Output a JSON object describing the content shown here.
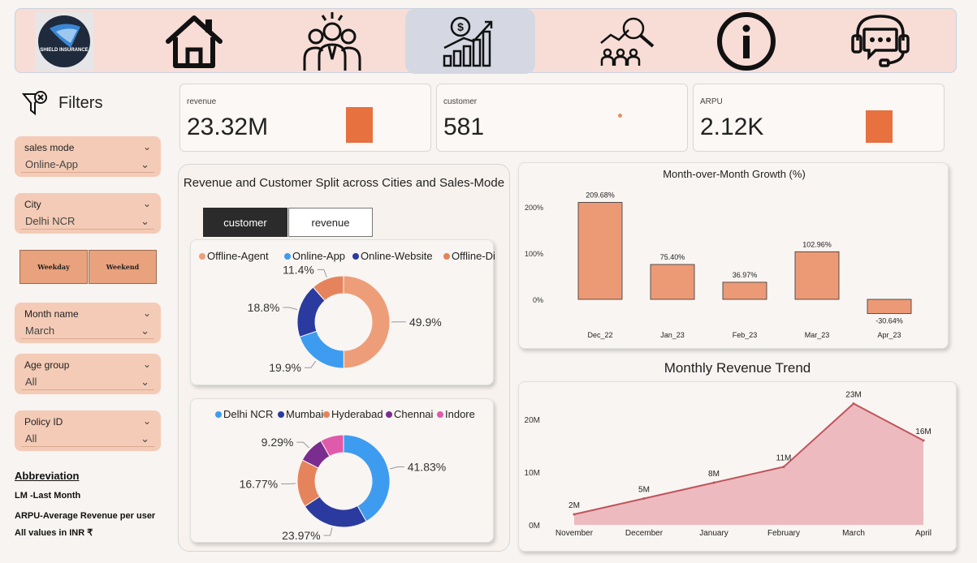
{
  "nav": {
    "logo_text": "SHIELD INSURANCE",
    "items": [
      {
        "icon": "home-icon"
      },
      {
        "icon": "team-icon"
      },
      {
        "icon": "revenue-growth-icon",
        "active": true
      },
      {
        "icon": "customer-research-icon"
      },
      {
        "icon": "info-icon"
      },
      {
        "icon": "support-chat-icon"
      }
    ]
  },
  "filters": {
    "title": "Filters",
    "slicers": [
      {
        "label": "sales mode",
        "value": "Online-App"
      },
      {
        "label": "City",
        "value": "Delhi NCR"
      },
      {
        "label": "Month name",
        "value": "March"
      },
      {
        "label": "Age group",
        "value": "All"
      },
      {
        "label": "Policy ID",
        "value": "All"
      }
    ],
    "weekday_label": "Weekday",
    "weekend_label": "Weekend"
  },
  "abbreviation": {
    "title": "Abbreviation",
    "lines": [
      "LM -Last Month",
      "ARPU-Average Revenue per user",
      "All values in INR ₹"
    ]
  },
  "kpis": [
    {
      "label": "revenue",
      "value": "23.32M"
    },
    {
      "label": "customer",
      "value": "581"
    },
    {
      "label": "ARPU",
      "value": "2.12K"
    }
  ],
  "split": {
    "title": "Revenue and Customer Split across Cities and Sales-Mode",
    "tabs": [
      "customer",
      "revenue"
    ]
  },
  "colors": {
    "accent": "#e7713f",
    "bar": "#ec9a76",
    "area": "#edbbbf",
    "area_line": "#c0545c"
  },
  "chart_data": [
    {
      "type": "pie",
      "title": "",
      "donut": true,
      "legend_position": "top",
      "labels": [
        "Offline-Agent",
        "Online-App",
        "Online-Website",
        "Offline-Direct"
      ],
      "values": [
        49.9,
        19.9,
        18.8,
        11.4
      ],
      "value_labels": [
        "49.9%",
        "19.9%",
        "18.8%",
        "11.4%"
      ],
      "colors": [
        "#ed9e78",
        "#3d9cf0",
        "#2b3a9f",
        "#e5845c"
      ]
    },
    {
      "type": "pie",
      "title": "",
      "donut": true,
      "legend_position": "top",
      "labels": [
        "Delhi NCR",
        "Mumbai",
        "Hyderabad",
        "Chennai",
        "Indore"
      ],
      "values": [
        41.83,
        23.97,
        16.77,
        9.29,
        8.14
      ],
      "value_labels": [
        "41.83%",
        "23.97%",
        "16.77%",
        "9.29%",
        ""
      ],
      "colors": [
        "#3d9cf0",
        "#2b3a9f",
        "#e5845c",
        "#7b2d8f",
        "#e05aab"
      ]
    },
    {
      "type": "bar",
      "title": "Month-over-Month Growth (%)",
      "categories": [
        "Dec_22",
        "Jan_23",
        "Feb_23",
        "Mar_23",
        "Apr_23"
      ],
      "values": [
        209.68,
        75.4,
        36.97,
        102.96,
        -30.64
      ],
      "value_labels": [
        "209.68%",
        "75.40%",
        "36.97%",
        "102.96%",
        "-30.64%"
      ],
      "yticks": [
        "0%",
        "100%",
        "200%"
      ],
      "ytick_values": [
        0,
        100,
        200
      ],
      "ylim": [
        -40,
        220
      ],
      "grid": false
    },
    {
      "type": "area",
      "title": "Monthly Revenue Trend",
      "categories": [
        "November",
        "December",
        "January",
        "February",
        "March",
        "April"
      ],
      "values": [
        2,
        5,
        8,
        11,
        23,
        16
      ],
      "value_labels": [
        "2M",
        "5M",
        "8M",
        "11M",
        "23M",
        "16M"
      ],
      "yticks": [
        "0M",
        "10M",
        "20M"
      ],
      "ytick_values": [
        0,
        10,
        20
      ],
      "ylim": [
        0,
        24
      ],
      "grid": false
    }
  ]
}
